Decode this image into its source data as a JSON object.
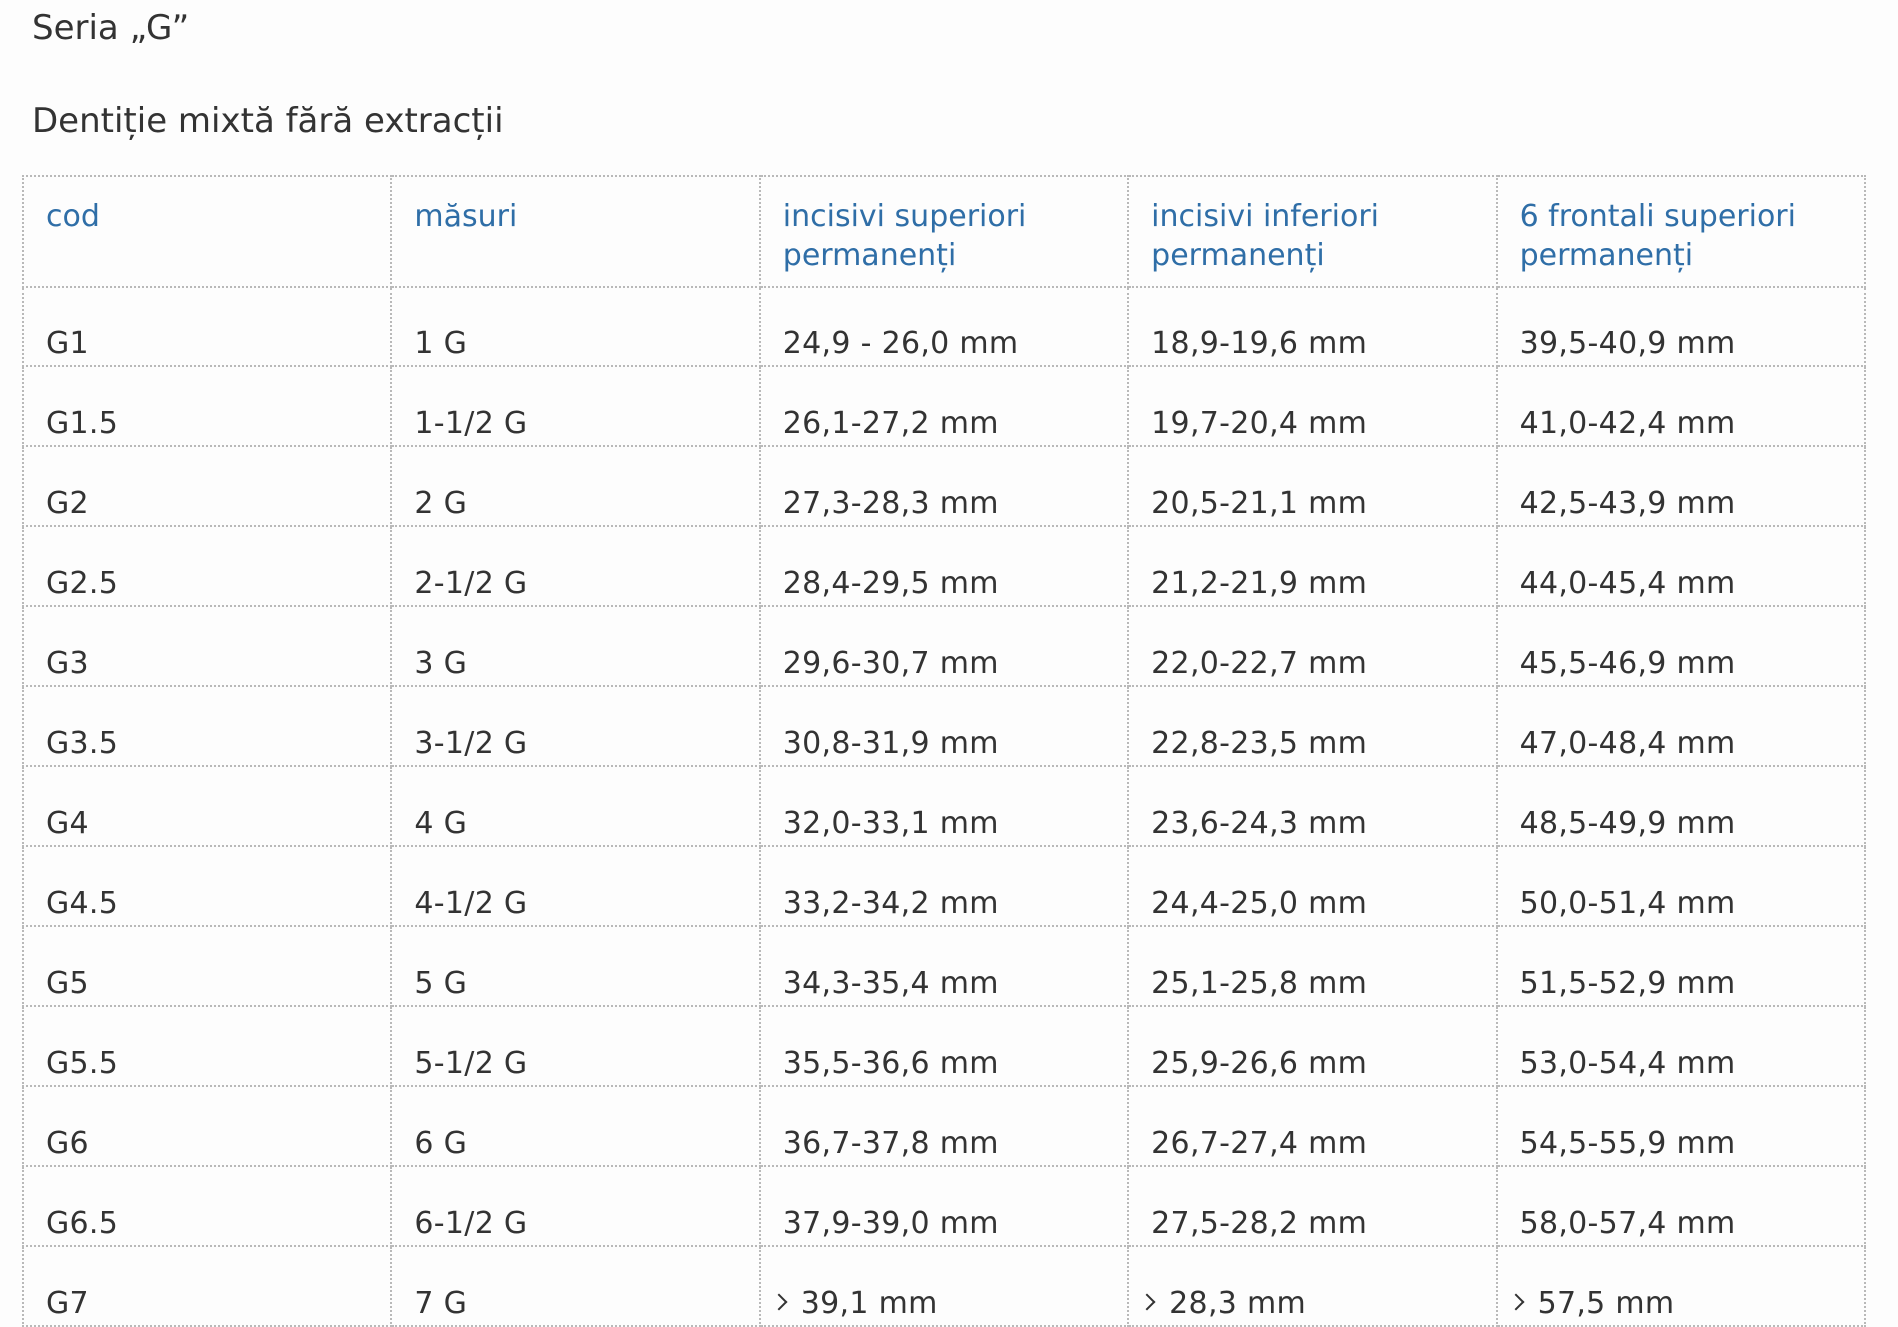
{
  "title": "Seria „G”",
  "subtitle": "Dentiție mixtă fără extracții",
  "table": {
    "headers": [
      "cod",
      "măsuri",
      "incisivi superiori permanenți",
      "incisivi inferiori permanenți",
      "6 frontali superiori permanenți"
    ],
    "rows": [
      [
        "G1",
        "1 G",
        "24,9 - 26,0 mm",
        "18,9-19,6 mm",
        "39,5-40,9 mm"
      ],
      [
        "G1.5",
        "1-1/2 G",
        "26,1-27,2 mm",
        "19,7-20,4 mm",
        "41,0-42,4 mm"
      ],
      [
        "G2",
        "2 G",
        "27,3-28,3 mm",
        "20,5-21,1 mm",
        "42,5-43,9 mm"
      ],
      [
        "G2.5",
        "2-1/2 G",
        "28,4-29,5 mm",
        "21,2-21,9 mm",
        "44,0-45,4 mm"
      ],
      [
        "G3",
        "3 G",
        "29,6-30,7 mm",
        "22,0-22,7 mm",
        "45,5-46,9 mm"
      ],
      [
        "G3.5",
        "3-1/2 G",
        "30,8-31,9 mm",
        "22,8-23,5 mm",
        "47,0-48,4 mm"
      ],
      [
        "G4",
        "4 G",
        "32,0-33,1 mm",
        "23,6-24,3 mm",
        "48,5-49,9 mm"
      ],
      [
        "G4.5",
        "4-1/2 G",
        "33,2-34,2 mm",
        "24,4-25,0 mm",
        "50,0-51,4 mm"
      ],
      [
        "G5",
        "5 G",
        "34,3-35,4 mm",
        "25,1-25,8 mm",
        "51,5-52,9 mm"
      ],
      [
        "G5.5",
        "5-1/2 G",
        "35,5-36,6 mm",
        "25,9-26,6 mm",
        "53,0-54,4 mm"
      ],
      [
        "G6",
        "6 G",
        "36,7-37,8 mm",
        "26,7-27,4 mm",
        "54,5-55,9 mm"
      ],
      [
        "G6.5",
        "6-1/2 G",
        "37,9-39,0 mm",
        "27,5-28,2 mm",
        "58,0-57,4 mm"
      ],
      [
        "G7",
        "7 G",
        "39,1 mm",
        "28,3 mm",
        "57,5 mm"
      ]
    ],
    "last_row_prefix_icon": "greater-than-icon",
    "header_color": "#2f6ea7",
    "text_color": "#333333",
    "border_color": "#b9b9b9"
  }
}
